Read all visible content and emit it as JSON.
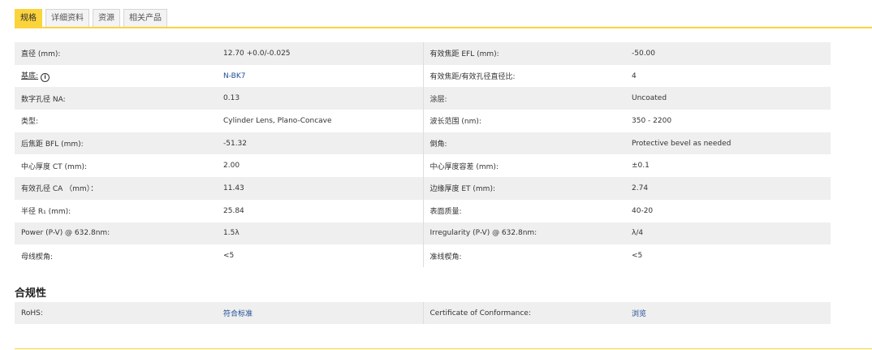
{
  "tabs": [
    {
      "label": "规格",
      "active": true
    },
    {
      "label": "详细资料",
      "active": false
    },
    {
      "label": "资源",
      "active": false
    },
    {
      "label": "相关产品",
      "active": false
    }
  ],
  "specs": [
    [
      {
        "label": "直径 (mm):",
        "value": "12.70 +0.0/-0.025"
      },
      {
        "label": "有效焦距 EFL (mm):",
        "value": "-50.00"
      }
    ],
    [
      {
        "label": "基底:",
        "value": "N-BK7",
        "info": "i",
        "link": true
      },
      {
        "label": "有效焦距/有效孔径直径比:",
        "value": "4"
      }
    ],
    [
      {
        "label": "数字孔径 NA:",
        "value": "0.13"
      },
      {
        "label": "涂层:",
        "value": "Uncoated"
      }
    ],
    [
      {
        "label": "类型:",
        "value": "Cylinder Lens, Plano-Concave"
      },
      {
        "label": "波长范围 (nm):",
        "value": "350 - 2200"
      }
    ],
    [
      {
        "label": "后焦距 BFL (mm):",
        "value": "-51.32"
      },
      {
        "label": "倒角:",
        "value": "Protective bevel as needed"
      }
    ],
    [
      {
        "label": "中心厚度 CT (mm):",
        "value": "2.00"
      },
      {
        "label": "中心厚度容差 (mm):",
        "value": "±0.1"
      }
    ],
    [
      {
        "label": "有效孔径 CA （mm）：",
        "value": "11.43"
      },
      {
        "label": "边缘厚度 ET (mm):",
        "value": "2.74"
      }
    ],
    [
      {
        "label": "半径 R₁ (mm):",
        "value": "25.84"
      },
      {
        "label": "表面质量:",
        "value": "40-20"
      }
    ],
    [
      {
        "label": "Power (P-V) @ 632.8nm:",
        "value": "1.5λ"
      },
      {
        "label": "Irregularity (P-V) @ 632.8nm:",
        "value": "λ/4"
      }
    ],
    [
      {
        "label": "母线楔角:",
        "value": "<5"
      },
      {
        "label": "准线楔角:",
        "value": "<5"
      }
    ]
  ],
  "compliance": {
    "title": "合规性",
    "rows": [
      [
        {
          "label": "RoHS:",
          "value": "符合标准",
          "link": true
        },
        {
          "label": "Certificate of Conformance:",
          "value": "浏览",
          "link": true
        }
      ]
    ]
  },
  "colors": {
    "accent": "#fbd33b",
    "link": "#1f4e96",
    "row_alt": "#efefef"
  }
}
